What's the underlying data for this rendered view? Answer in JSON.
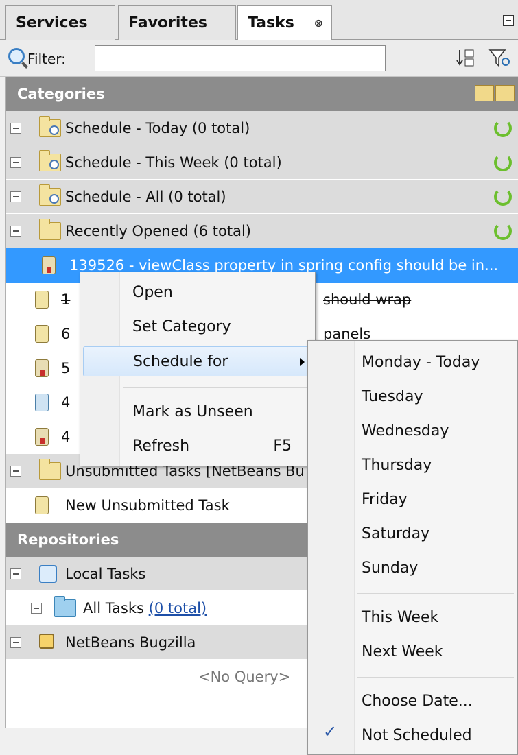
{
  "tabs": [
    {
      "label": "Services"
    },
    {
      "label": "Favorites"
    },
    {
      "label": "Tasks",
      "close": "⊗"
    }
  ],
  "filter": {
    "label": "Filter:",
    "value": "",
    "placeholder": ""
  },
  "categories": {
    "header": "Categories",
    "items": [
      {
        "label": "Schedule - Today  (0 total)"
      },
      {
        "label": "Schedule - This Week  (0 total)"
      },
      {
        "label": "Schedule - All  (0 total)"
      },
      {
        "label": "Recently Opened  (6 total)"
      }
    ],
    "recent_tasks": [
      {
        "label": "139526 - viewClass property in spring config should be in..."
      },
      {
        "label": "1",
        "hidden_suffix": "should wrap"
      },
      {
        "label": "6",
        "hidden_suffix": "panels"
      },
      {
        "label": "5"
      },
      {
        "label": "4"
      },
      {
        "label": "4"
      }
    ],
    "unsubmitted": {
      "label": "Unsubmitted Tasks [NetBeans Bu"
    },
    "new_task": {
      "label": "New Unsubmitted Task"
    }
  },
  "repositories": {
    "header": "Repositories",
    "local": {
      "label": "Local Tasks"
    },
    "all_tasks": {
      "label": "All Tasks  ",
      "count": "(0 total)"
    },
    "bugzilla": {
      "label": "NetBeans Bugzilla"
    },
    "no_query": "<No Query>"
  },
  "context_menu": {
    "open": "Open",
    "set_category": "Set Category",
    "schedule_for": "Schedule for",
    "mark_unseen": "Mark as Unseen",
    "refresh": "Refresh",
    "refresh_shortcut": "F5"
  },
  "submenu": {
    "days": [
      "Monday - Today",
      "Tuesday",
      "Wednesday",
      "Thursday",
      "Friday",
      "Saturday",
      "Sunday"
    ],
    "this_week": "This Week",
    "next_week": "Next Week",
    "choose_date": "Choose Date...",
    "not_scheduled": "Not Scheduled",
    "check": "✓"
  }
}
